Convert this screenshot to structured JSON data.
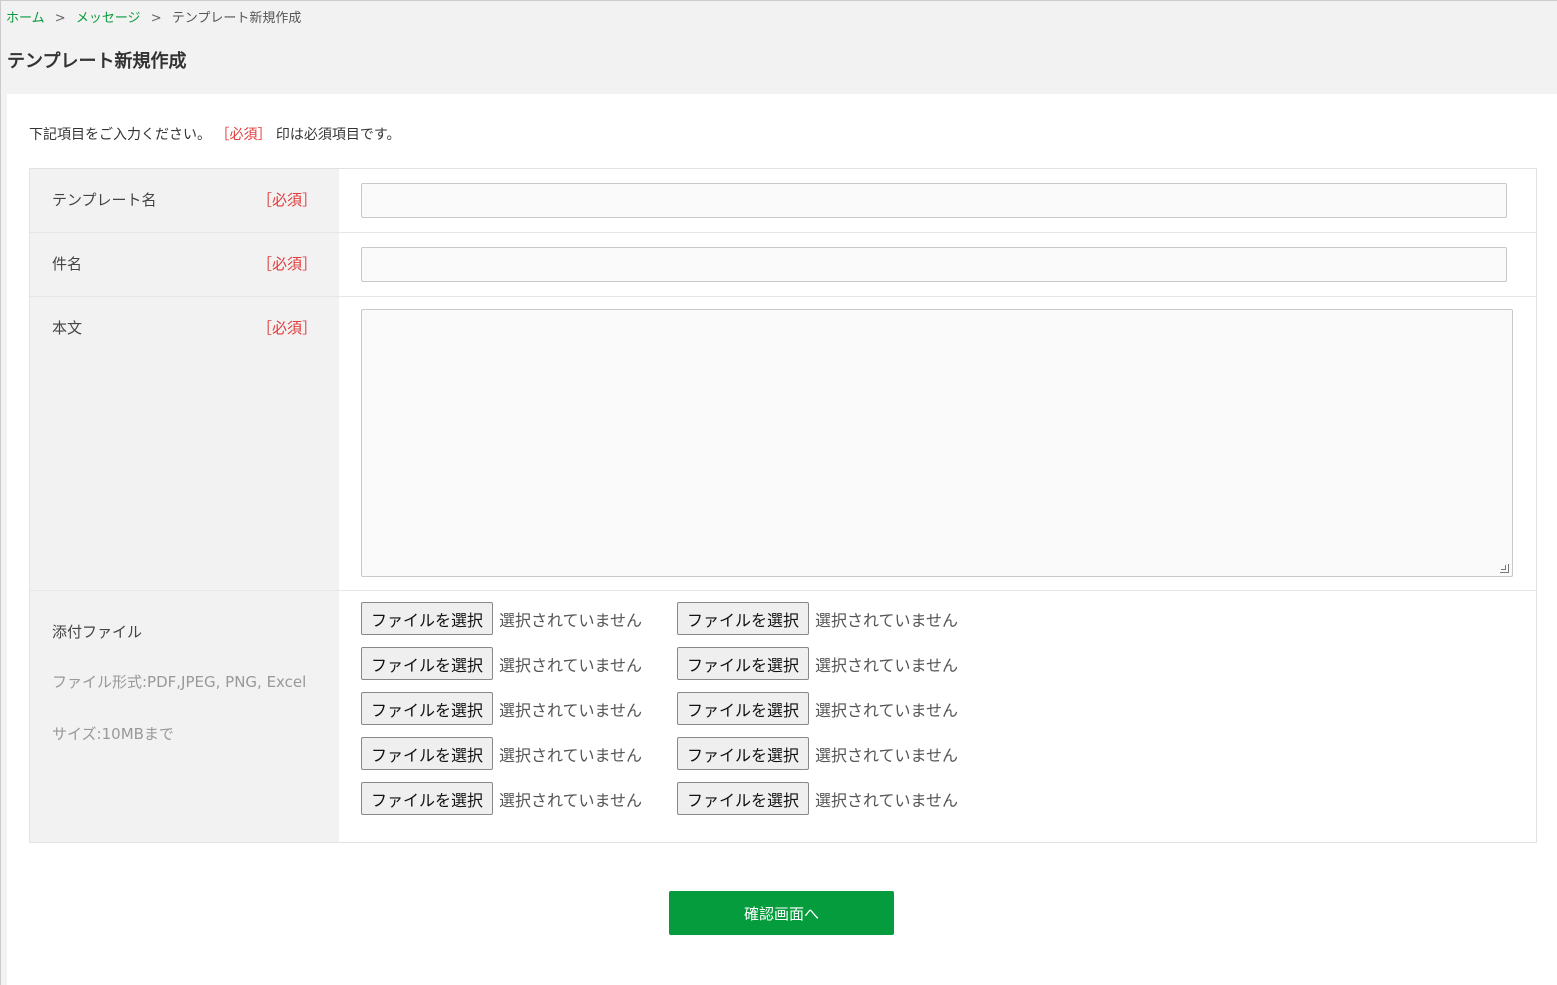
{
  "breadcrumb": {
    "home": "ホーム",
    "separator": ">",
    "messages": "メッセージ",
    "current": "テンプレート新規作成"
  },
  "page_title": "テンプレート新規作成",
  "intro": {
    "before": "下記項目をご入力ください。",
    "required_mark": "［必須］",
    "after": "印は必須項目です。"
  },
  "form": {
    "required_tag": "［必須］",
    "template_name_label": "テンプレート名",
    "subject_label": "件名",
    "body_label": "本文",
    "attachment_label": "添付ファイル",
    "attachment_formats": "ファイル形式:PDF,JPEG, PNG, Excel",
    "attachment_size": "サイズ:10MBまで",
    "template_name_value": "",
    "subject_value": "",
    "body_value": ""
  },
  "file_button_label": "ファイルを選択",
  "file_status": "選択されていません",
  "confirm_button": "確認画面へ",
  "colors": {
    "accent_green": "#059c3d",
    "link_green": "#0a9a3c",
    "required_red": "#e03c3c"
  }
}
